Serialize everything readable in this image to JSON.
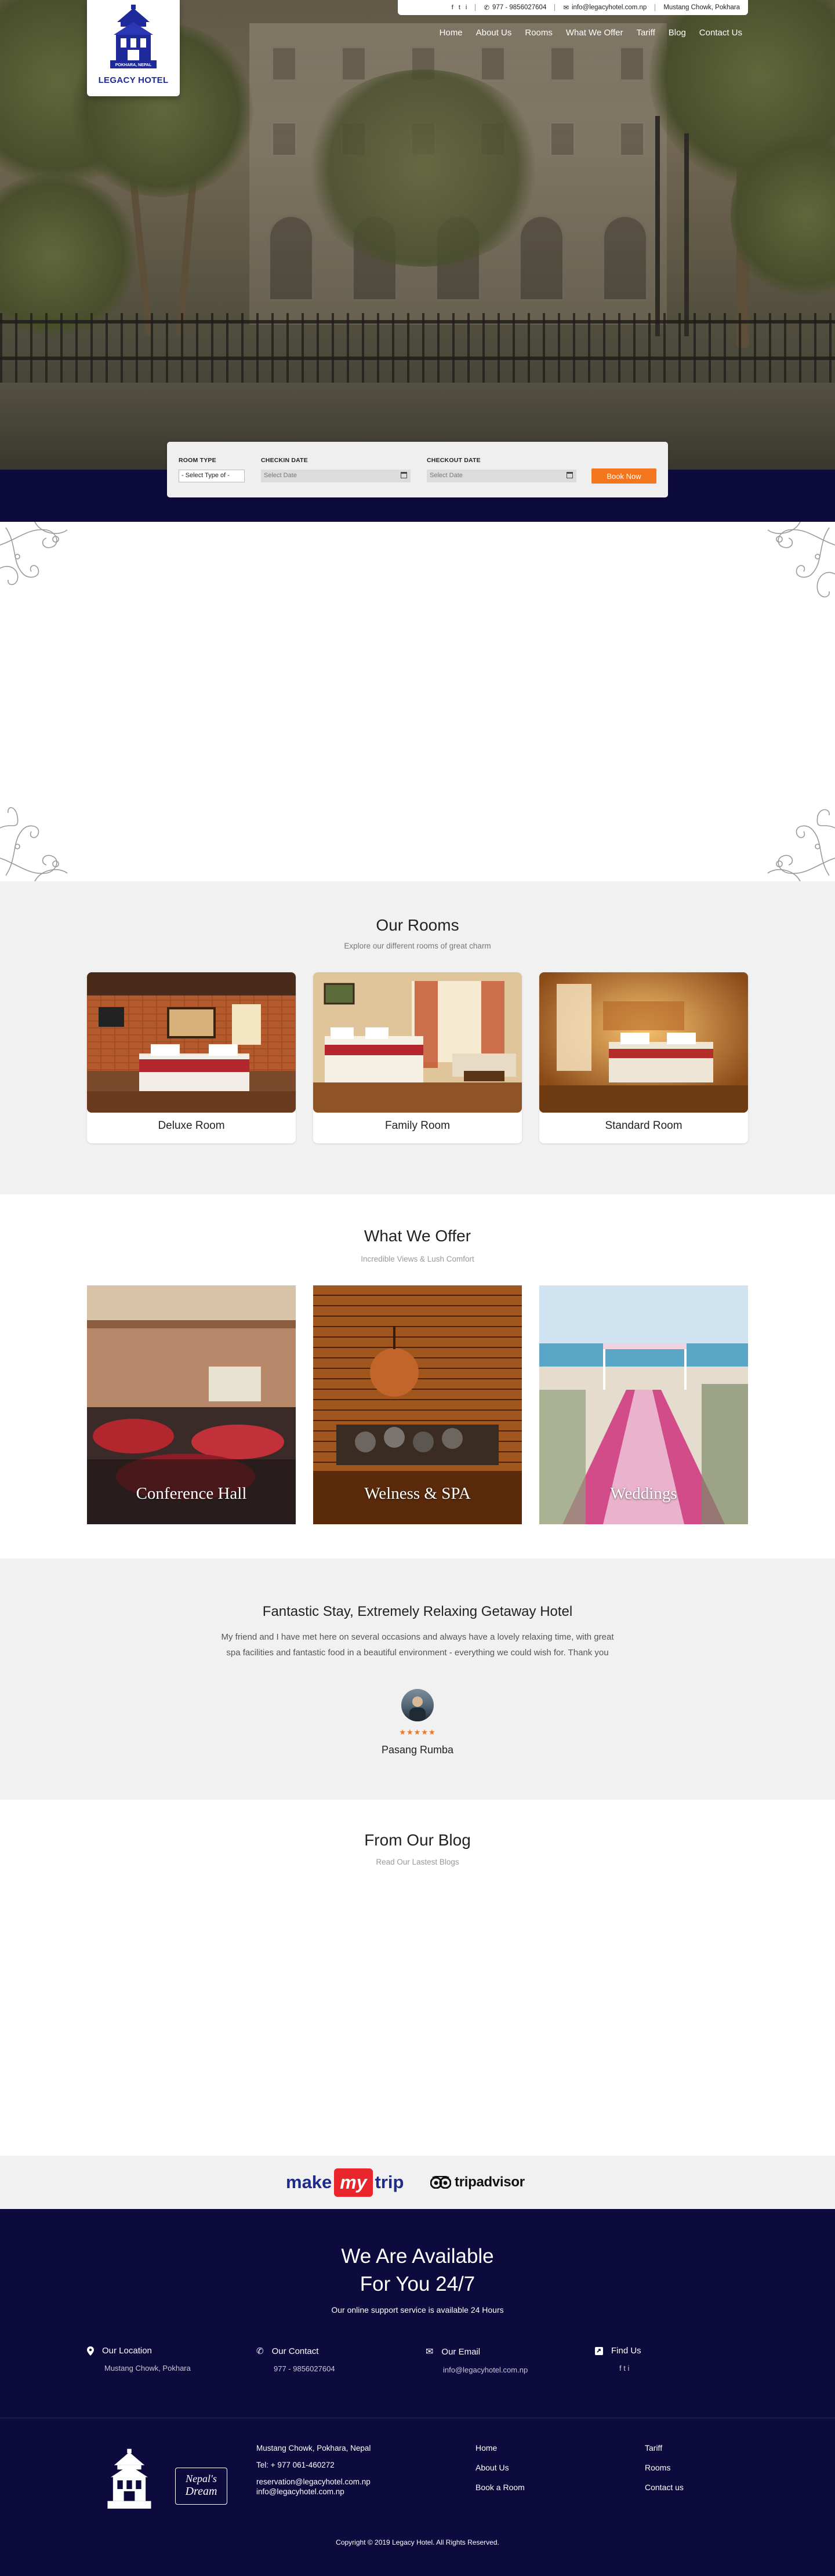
{
  "topbar": {
    "social": [
      "f",
      "t",
      "i"
    ],
    "phone": "977 - 9856027604",
    "email": "info@legacyhotel.com.np",
    "location": "Mustang Chowk, Pokhara"
  },
  "logo": {
    "name": "LEGACY HOTEL",
    "tagline": "POKHARA, NEPAL"
  },
  "nav": [
    "Home",
    "About Us",
    "Rooms",
    "What We Offer",
    "Tariff",
    "Blog",
    "Contact Us"
  ],
  "booking": {
    "room_type_label": "ROOM TYPE",
    "room_type_value": "- Select Type of -",
    "checkin_label": "CHECKIN DATE",
    "checkin_placeholder": "Select Date",
    "checkout_label": "CHECKOUT DATE",
    "checkout_placeholder": "Select Date",
    "button": "Book Now"
  },
  "rooms": {
    "title": "Our Rooms",
    "subtitle": "Explore our different rooms of great charm",
    "items": [
      {
        "name": "Deluxe Room"
      },
      {
        "name": "Family Room"
      },
      {
        "name": "Standard Room"
      }
    ]
  },
  "offer": {
    "title": "What We Offer",
    "subtitle": "Incredible Views & Lush Comfort",
    "items": [
      {
        "name": "Conference Hall"
      },
      {
        "name": "Welness & SPA"
      },
      {
        "name": "Weddings"
      }
    ]
  },
  "testimonial": {
    "title": "Fantastic Stay, Extremely Relaxing Getaway Hotel",
    "text": "My friend and I have met here on several occasions and always have a lovely relaxing time, with great spa facilities and fantastic food in a beautiful environment - everything we could wish for. Thank you",
    "stars": "★★★★★",
    "name": "Pasang Rumba"
  },
  "blog": {
    "title": "From Our Blog",
    "subtitle": "Read Our Lastest Blogs"
  },
  "partners": {
    "makemytrip_left": "make",
    "makemytrip_mid": "my",
    "makemytrip_right": "trip",
    "tripadvisor": "tripadvisor"
  },
  "footer": {
    "headline_1": "We Are Available",
    "headline_2": "For You 24/7",
    "note": "Our online support service is available 24 Hours",
    "columns": [
      {
        "title": "Our Location",
        "value": "Mustang Chowk, Pokhara"
      },
      {
        "title": "Our Contact",
        "value": "977 - 9856027604"
      },
      {
        "title": "Our Email",
        "value": "info@legacyhotel.com.np"
      },
      {
        "title": "Find Us",
        "value": "f  t  i"
      }
    ],
    "address_lines": [
      "Mustang Chowk, Pokhara, Nepal",
      "Tel: + 977 061-460272",
      "reservation@legacyhotel.com.np",
      "info@legacyhotel.com.np"
    ],
    "links_col1": [
      "Home",
      "About Us",
      "Book a Room"
    ],
    "links_col2": [
      "Tariff",
      "Rooms",
      "Contact us"
    ],
    "script_logo_1": "Nepal's",
    "script_logo_2": "Dream",
    "copyright": "Copyright © 2019 Legacy Hotel. All Rights Reserved."
  },
  "colors": {
    "navy": "#0d0a3d",
    "accent": "#f3751e",
    "logo_blue": "#1f2a9a",
    "section_gray": "#f1f1f1"
  }
}
